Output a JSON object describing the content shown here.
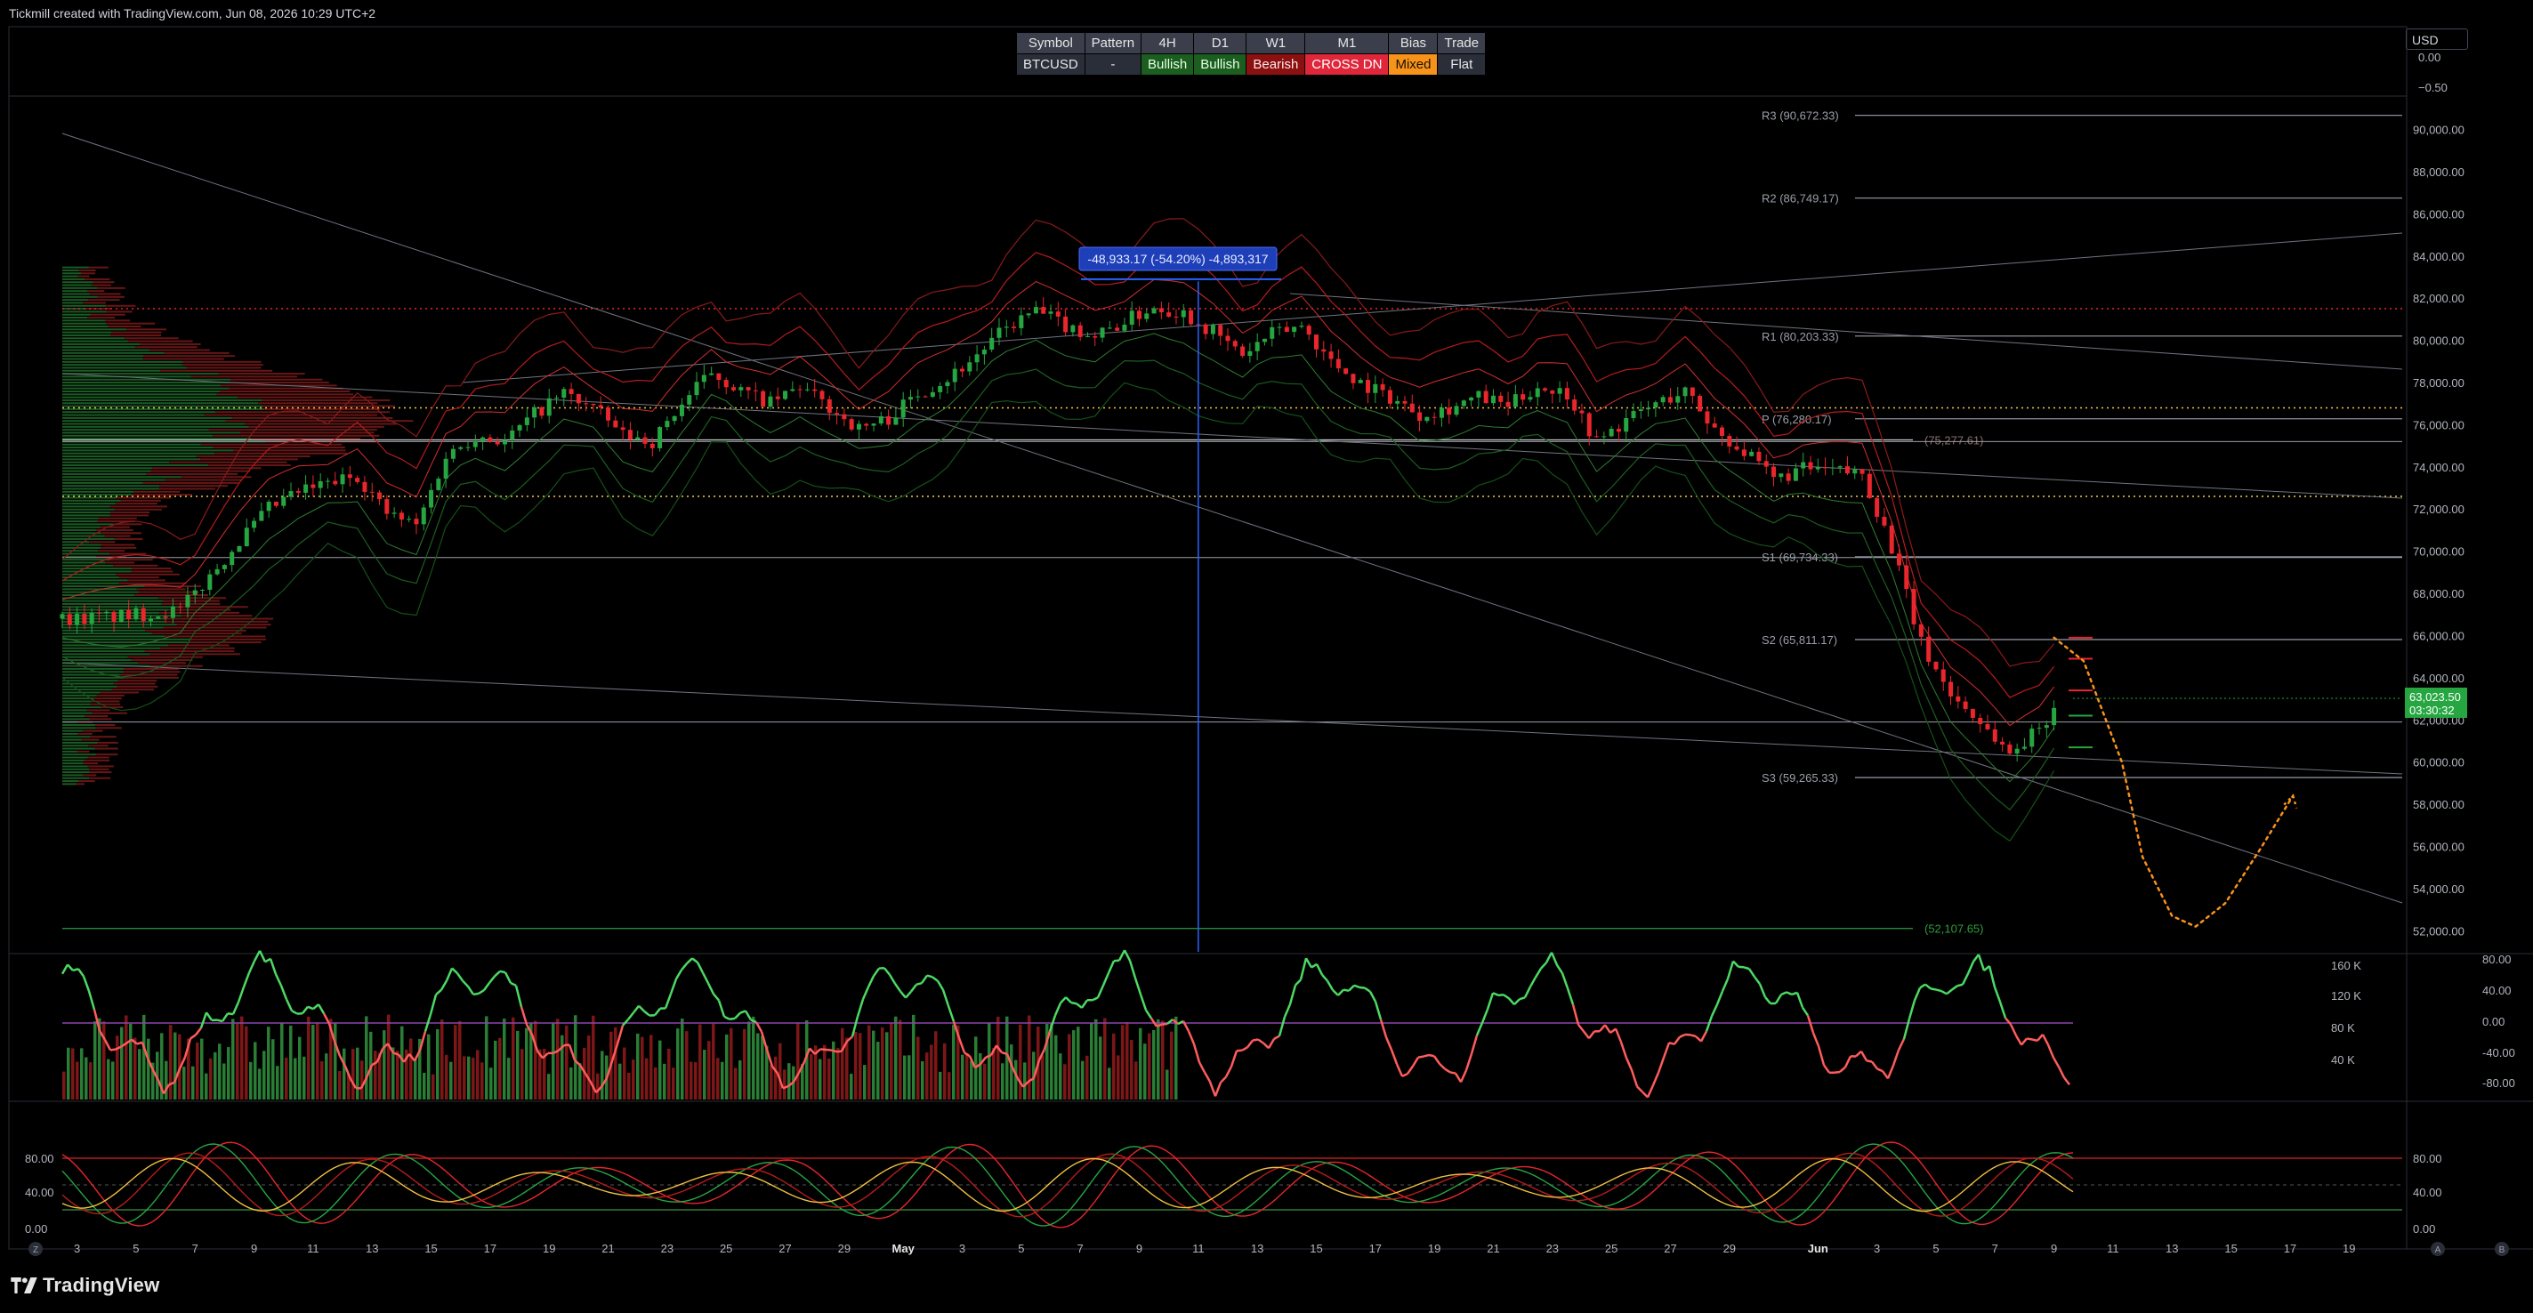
{
  "header": {
    "caption": "Tickmill created with TradingView.com, Jun 08, 2026 10:29 UTC+2"
  },
  "currency": "USD",
  "status_table": {
    "headers": [
      "Symbol",
      "Pattern",
      "4H",
      "D1",
      "W1",
      "M1",
      "Bias",
      "Trade"
    ],
    "values": [
      "BTCUSD",
      "-",
      "Bullish",
      "Bullish",
      "Bearish",
      "CROSS DN",
      "Mixed",
      "Flat"
    ],
    "value_states": [
      "neutral",
      "neutral",
      "bullish",
      "bullish",
      "bearish",
      "cross",
      "mixed",
      "neutral"
    ]
  },
  "measure_label": "-48,933.17 (-54.20%) -4,893,317",
  "price_badge": {
    "price": "63,023.50",
    "countdown": "03:30:32",
    "value": 63023.5
  },
  "colors": {
    "up": "#26a641",
    "down": "#e8262c",
    "band_red": "#b71c1c",
    "band_green": "#2e7d32",
    "projection": "#f7931a",
    "measure_blue": "#2962ff",
    "rsi_mid": "#8e44ad"
  },
  "footer": {
    "brand": "TradingView"
  },
  "chart_data": [
    {
      "type": "line",
      "pane": "price",
      "symbol": "BTCUSD",
      "x_axis": {
        "tick_labels": [
          "3",
          "5",
          "7",
          "9",
          "11",
          "13",
          "15",
          "17",
          "19",
          "21",
          "23",
          "25",
          "27",
          "29",
          "May",
          "3",
          "5",
          "7",
          "9",
          "11",
          "13",
          "15",
          "17",
          "19",
          "21",
          "23",
          "25",
          "27",
          "29",
          "Jun",
          "3",
          "5",
          "7",
          "9",
          "11",
          "13",
          "15",
          "17",
          "19"
        ],
        "start": "Apr 01",
        "end": "Jun 20"
      },
      "y_axis": {
        "tick_labels": [
          "52,000.00",
          "54,000.00",
          "56,000.00",
          "58,000.00",
          "60,000.00",
          "62,000.00",
          "64,000.00",
          "66,000.00",
          "68,000.00",
          "70,000.00",
          "72,000.00",
          "74,000.00",
          "76,000.00",
          "78,000.00",
          "80,000.00",
          "82,000.00",
          "84,000.00",
          "86,000.00",
          "88,000.00",
          "90,000.00"
        ],
        "ylim": [
          51000,
          91500
        ]
      },
      "price_path": {
        "x_day": [
          0,
          2,
          4,
          5,
          6,
          7,
          8,
          9,
          10,
          11,
          12,
          13,
          14,
          15,
          16,
          17,
          18,
          19,
          20,
          21,
          22,
          23,
          24,
          25,
          26,
          27,
          28,
          29,
          30,
          31,
          32,
          33,
          34,
          35,
          36,
          37,
          38,
          39,
          40,
          41,
          42,
          43,
          44,
          45,
          46,
          47,
          48,
          49,
          50,
          51,
          52,
          53,
          54,
          55,
          56,
          57,
          58,
          59,
          60,
          61,
          62,
          63,
          64,
          65,
          66,
          67,
          67.5
        ],
        "close": [
          66800,
          66900,
          67200,
          68800,
          70500,
          72000,
          72800,
          73200,
          73600,
          71800,
          71200,
          74500,
          75500,
          75200,
          76500,
          77500,
          76800,
          75500,
          75200,
          77000,
          78500,
          77600,
          77000,
          77800,
          76800,
          75800,
          76300,
          77500,
          78200,
          79300,
          80600,
          81400,
          80700,
          80200,
          80900,
          81600,
          81300,
          80400,
          79300,
          80300,
          80700,
          79000,
          78000,
          77300,
          76500,
          76800,
          77300,
          76900,
          77800,
          77500,
          75200,
          76200,
          77000,
          77600,
          75800,
          74700,
          73400,
          73900,
          73800,
          73700,
          70200,
          65600,
          63200,
          61900,
          60400,
          61600,
          62600
        ]
      },
      "pivot_levels": [
        {
          "label": "R3 (90,672.33)",
          "value": 90672.33
        },
        {
          "label": "R2 (86,749.17)",
          "value": 86749.17
        },
        {
          "label": "R1 (80,203.33)",
          "value": 80203.33
        },
        {
          "label": "P (76,280.17)",
          "value": 76280.17
        },
        {
          "label": "S1 (69,734.33)",
          "value": 69734.33
        },
        {
          "label": "S2 (65,811.17)",
          "value": 65811.17
        },
        {
          "label": "S3 (59,265.33)",
          "value": 59265.33
        }
      ],
      "horizontal_levels": [
        {
          "label": "(75,277.61)",
          "value": 75277.61
        },
        {
          "label": "(52,107.65)",
          "value": 52107.65
        }
      ],
      "dotted_levels": [
        81500,
        76800,
        72600
      ],
      "projection_path": {
        "x_day": [
          67.5,
          68.5,
          69.8,
          70.5,
          71.5,
          72.3,
          73.3,
          74.5,
          75.6
        ],
        "value": [
          65900,
          64800,
          60000,
          55500,
          52700,
          52200,
          53300,
          55900,
          58400
        ]
      },
      "measure": {
        "x_day": 38.5,
        "from": 82800,
        "to": 51200
      }
    },
    {
      "type": "bar",
      "pane": "volume_rsi",
      "y_axis_right": {
        "tick_labels": [
          "80.00",
          "40.00",
          "0.00",
          "-40.00",
          "-80.00"
        ]
      },
      "y_axis_left": {
        "tick_labels": [
          "160 K",
          "120 K",
          "80 K",
          "40 K"
        ]
      },
      "note": "Volume histogram with RSI-style oscillator overlay"
    },
    {
      "type": "line",
      "pane": "stochastic",
      "y_axis_left": {
        "tick_labels": [
          "80.00",
          "40.00",
          "0.00"
        ]
      },
      "y_axis_right": {
        "tick_labels": [
          "80.00",
          "40.00",
          "0.00"
        ]
      },
      "bands": [
        80,
        20
      ]
    }
  ]
}
